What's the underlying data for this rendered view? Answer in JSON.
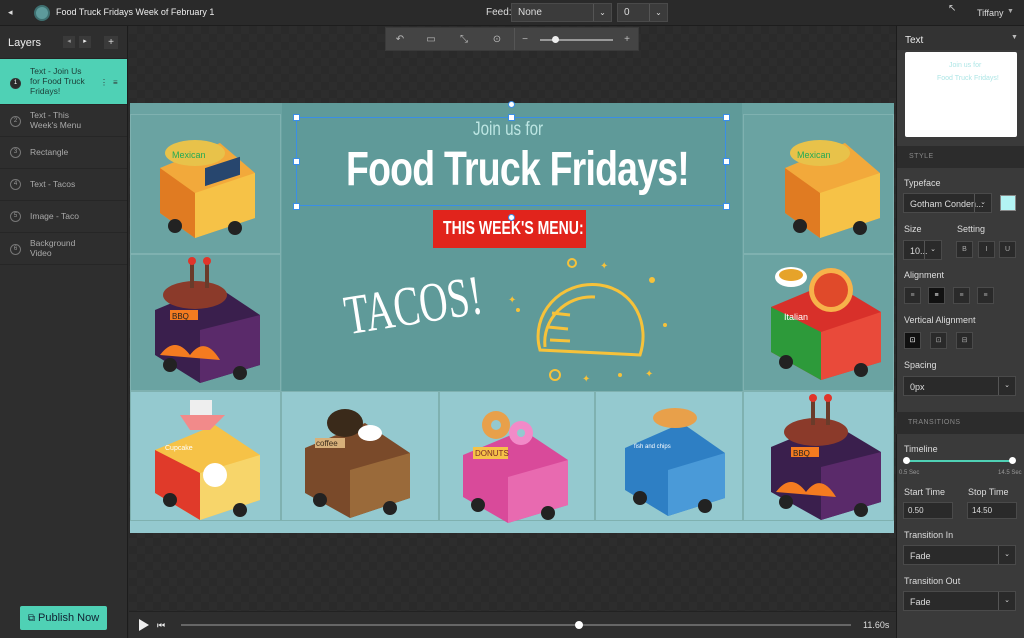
{
  "topbar": {
    "title": "Food Truck Fridays Week of February 1",
    "feed_label": "Feed:",
    "feed_value": "None",
    "feed_index": "0",
    "user": "Tiffany"
  },
  "layers": {
    "title": "Layers",
    "items": [
      {
        "num": "1",
        "label": "Text - Join Us for Food Truck Fridays!"
      },
      {
        "num": "2",
        "label": "Text - This Week's Menu"
      },
      {
        "num": "3",
        "label": "Rectangle"
      },
      {
        "num": "4",
        "label": "Text - Tacos"
      },
      {
        "num": "5",
        "label": "Image - Taco"
      },
      {
        "num": "6",
        "label": "Background Video"
      }
    ],
    "publish_label": "Publish Now"
  },
  "canvas": {
    "join_text": "Join us for",
    "title_text": "Food Truck Fridays!",
    "menu_text": "THIS WEEK'S MENU:",
    "tacos_text": "TACOS!",
    "truck_labels": [
      "Mexican",
      "BBQ",
      "Italian",
      "Cupcake",
      "coffee",
      "DONUTS",
      "fish and chips",
      "BBQ",
      "Mexican"
    ]
  },
  "playback": {
    "time": "11.60s",
    "progress": 0.594
  },
  "properties": {
    "panel_title": "Text",
    "preview_line1": "Join us for",
    "preview_line2": "Food Truck Fridays!",
    "style_section": "STYLE",
    "typeface_label": "Typeface",
    "typeface_value": "Gotham Conden...",
    "font_color": "#b3f4f4",
    "size_label": "Size",
    "size_value": "10...",
    "setting_label": "Setting",
    "alignment_label": "Alignment",
    "vertical_alignment_label": "Vertical Alignment",
    "spacing_label": "Spacing",
    "spacing_value": "0px",
    "transitions_section": "TRANSITIONS",
    "timeline_label": "Timeline",
    "timeline_min": "0.5 Sec",
    "timeline_max": "14.5 Sec",
    "start_time_label": "Start Time",
    "start_time_value": "0.50",
    "stop_time_label": "Stop Time",
    "stop_time_value": "14.50",
    "transition_in_label": "Transition In",
    "transition_in_value": "Fade",
    "transition_out_label": "Transition Out",
    "transition_out_value": "Fade"
  },
  "colors": {
    "accent": "#4fd1b5",
    "selection": "#3a8ee6",
    "banner_red": "#e1241c",
    "stage_teal": "#6aa3a2"
  }
}
